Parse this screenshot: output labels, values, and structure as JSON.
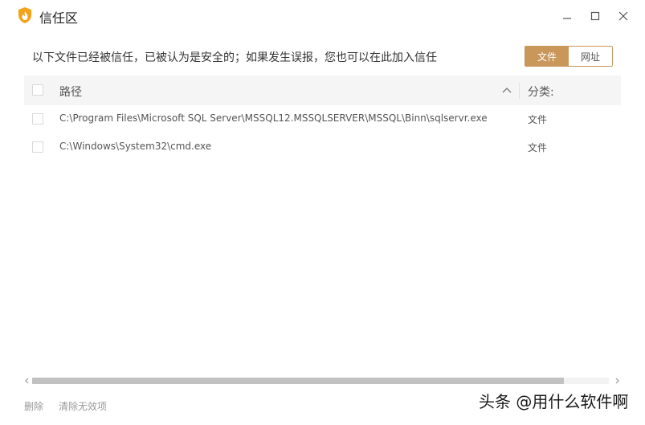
{
  "window": {
    "title": "信任区"
  },
  "description": "以下文件已经被信任，已被认为是安全的；如果发生误报，您也可以在此加入信任",
  "tabs": [
    {
      "label": "文件",
      "active": true
    },
    {
      "label": "网址",
      "active": false
    }
  ],
  "table": {
    "columns": {
      "path": "路径",
      "category": "分类:"
    },
    "rows": [
      {
        "path": "C:\\Program Files\\Microsoft SQL Server\\MSSQL12.MSSQLSERVER\\MSSQL\\Binn\\sqlservr.exe",
        "category": "文件",
        "checked": false
      },
      {
        "path": "C:\\Windows\\System32\\cmd.exe",
        "category": "文件",
        "checked": false
      }
    ]
  },
  "footer": {
    "delete_label": "删除",
    "clear_invalid_label": "清除无效项"
  },
  "watermark": "头条 @用什么软件啊",
  "colors": {
    "accent": "#c9975a",
    "header_bg": "#f5f5f5",
    "scrollbar_thumb": "#c1c1c1"
  },
  "icons": {
    "app": "shield-flame-icon",
    "minimize": "minimize-icon",
    "maximize": "maximize-icon",
    "close": "close-icon",
    "sort": "chevron-up-icon"
  }
}
